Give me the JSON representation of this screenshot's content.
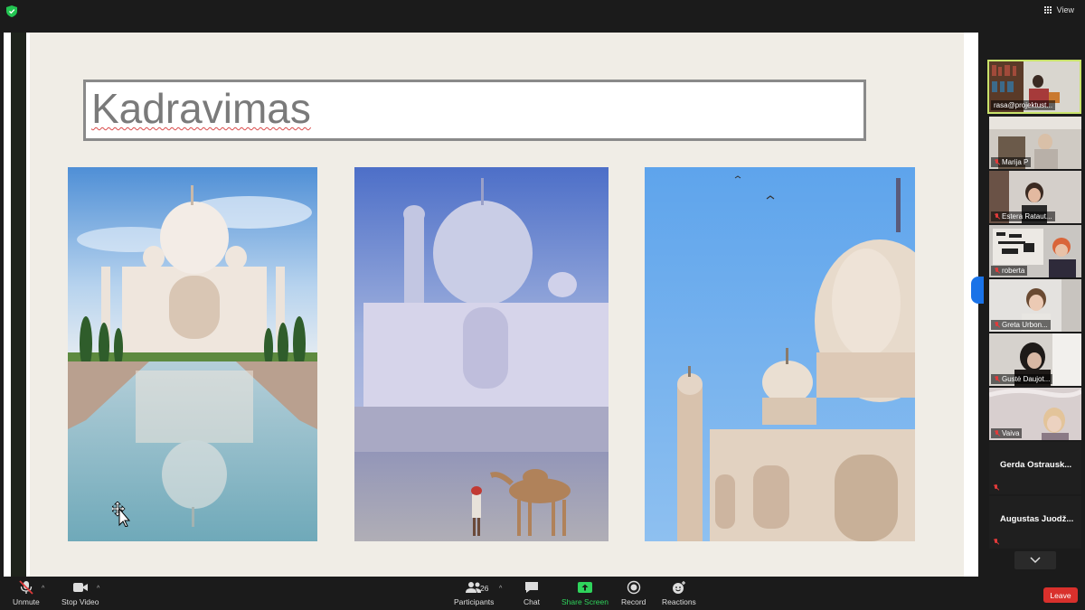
{
  "window": {
    "view_label": "View"
  },
  "slide": {
    "title": "Kadravimas"
  },
  "participants_gallery": [
    {
      "name": "rasa@projektust...",
      "active": true
    },
    {
      "name": "Marija P",
      "muted": true
    },
    {
      "name": "Estera Rataut...",
      "muted": true
    },
    {
      "name": "roberta",
      "muted": true
    },
    {
      "name": "Greta Urbon...",
      "muted": true
    },
    {
      "name": "Gustė Daujot...",
      "muted": true
    },
    {
      "name": "Vaiva",
      "muted": true
    },
    {
      "name": "Gerda  Ostrausk...",
      "muted": true,
      "video": false
    },
    {
      "name": "Augustas  Juodž...",
      "muted": true,
      "video": false
    }
  ],
  "toolbar": {
    "unmute": "Unmute",
    "stop_video": "Stop Video",
    "participants": "Participants",
    "participants_count": "26",
    "chat": "Chat",
    "share_screen": "Share Screen",
    "record": "Record",
    "reactions": "Reactions",
    "leave": "Leave"
  },
  "colors": {
    "accent_green": "#2fd45c",
    "leave_red": "#d9302c",
    "active_border": "#c9e36b"
  },
  "icons": [
    "shield-icon",
    "grid-icon",
    "mic-off-icon",
    "video-icon",
    "participants-icon",
    "chat-icon",
    "share-screen-icon",
    "record-icon",
    "reactions-icon",
    "chevron-down-icon",
    "move-cursor-icon"
  ]
}
